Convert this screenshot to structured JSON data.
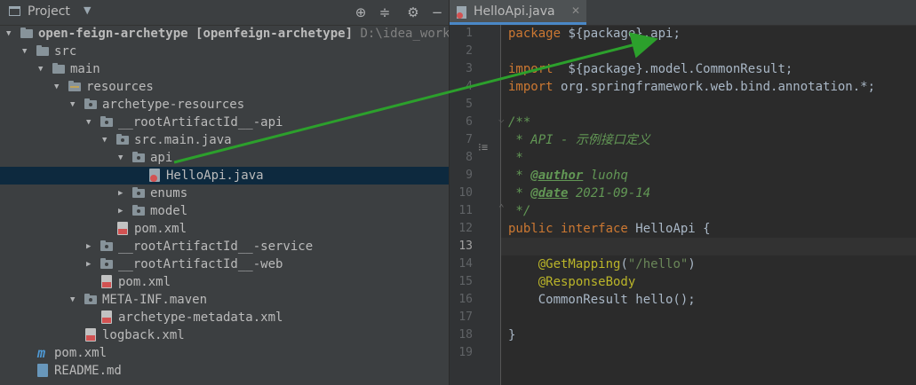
{
  "project_panel": {
    "title": "Project",
    "tree": [
      {
        "label": "open-feign-archetype",
        "extra": "[openfeign-archetype]",
        "path": "D:\\idea_workspa"
      },
      {
        "label": "src"
      },
      {
        "label": "main"
      },
      {
        "label": "resources"
      },
      {
        "label": "archetype-resources"
      },
      {
        "label": "__rootArtifactId__-api"
      },
      {
        "label": "src.main.java"
      },
      {
        "label": "api"
      },
      {
        "label": "HelloApi.java"
      },
      {
        "label": "enums"
      },
      {
        "label": "model"
      },
      {
        "label": "pom.xml"
      },
      {
        "label": "__rootArtifactId__-service"
      },
      {
        "label": "__rootArtifactId__-web"
      },
      {
        "label": "pom.xml"
      },
      {
        "label": "META-INF.maven"
      },
      {
        "label": "archetype-metadata.xml"
      },
      {
        "label": "logback.xml"
      },
      {
        "label": "pom.xml"
      },
      {
        "label": "README.md"
      }
    ]
  },
  "editor": {
    "tab_label": "HelloApi.java",
    "line_numbers": [
      "1",
      "2",
      "3",
      "4",
      "5",
      "6",
      "7",
      "8",
      "9",
      "10",
      "11",
      "12",
      "13",
      "14",
      "15",
      "16",
      "17",
      "18",
      "19"
    ],
    "code": {
      "l1_kw": "package",
      "l1_rest": " ${package}.api;",
      "l3_kw": "import",
      "l3_rest": "  ${package}.model.CommonResult;",
      "l4_kw": "import",
      "l4_rest": " org.springframework.web.bind.annotation.*;",
      "l6": "/**",
      "l7": " * API - 示例接口定义",
      "l8": " *",
      "l9_star": " * ",
      "l9_tag": "@author",
      "l9_val": " luohq",
      "l10_star": " * ",
      "l10_tag": "@date",
      "l10_val": " 2021-09-14",
      "l11": " */",
      "l12_kw1": "public",
      "l12_kw2": " interface",
      "l12_rest": " HelloApi {",
      "l14_an": "    @GetMapping",
      "l14_p1": "(",
      "l14_str": "\"/hello\"",
      "l14_p2": ")",
      "l15_an": "    @ResponseBody",
      "l16": "    CommonResult hello();",
      "l18": "}"
    }
  },
  "annotation_color": "#2ca02c"
}
